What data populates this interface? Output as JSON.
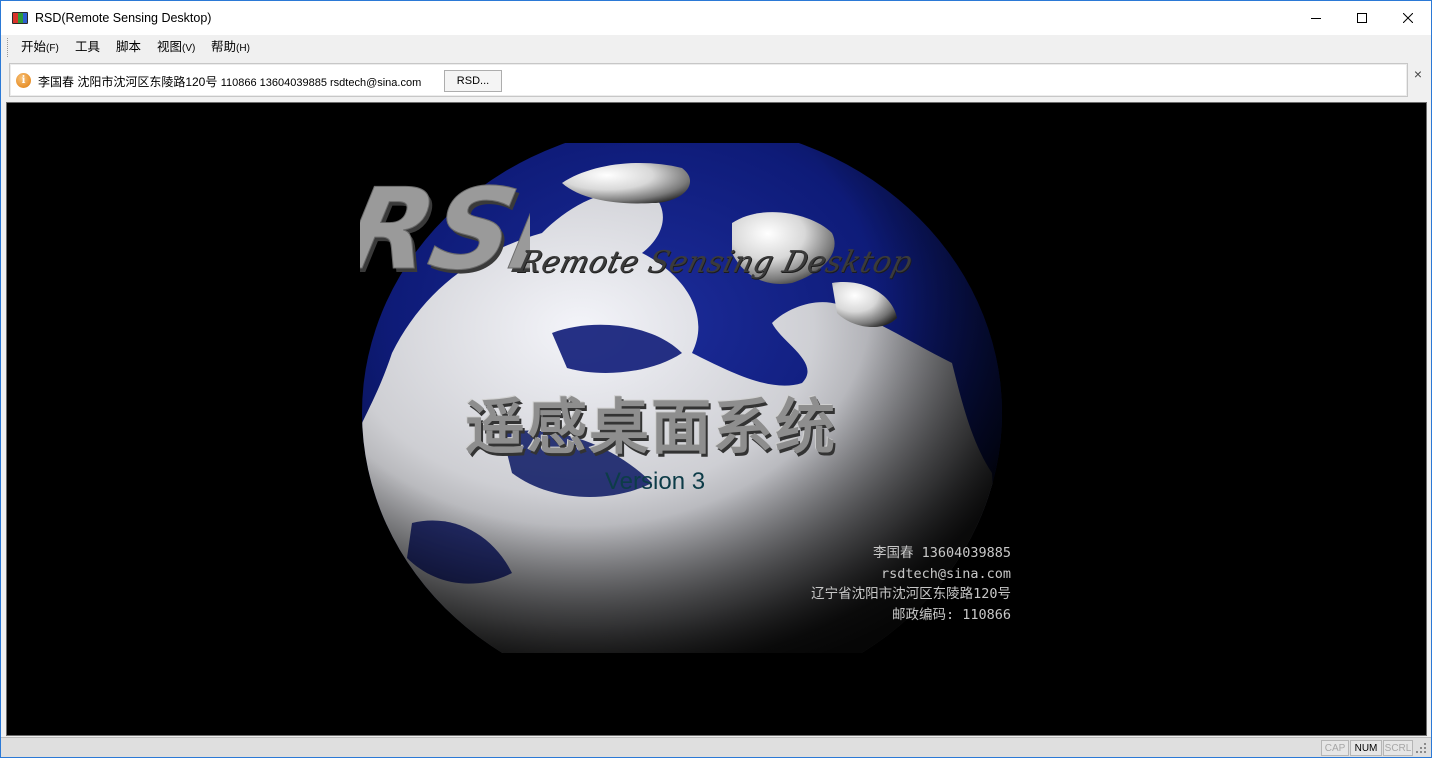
{
  "window": {
    "title": "RSD(Remote Sensing Desktop)",
    "icon": "rsd-app-icon"
  },
  "menubar": {
    "items": [
      {
        "label": "开始",
        "hotkey": "(F)"
      },
      {
        "label": "工具",
        "hotkey": ""
      },
      {
        "label": "脚本",
        "hotkey": ""
      },
      {
        "label": "视图",
        "hotkey": "(V)"
      },
      {
        "label": "帮助",
        "hotkey": "(H)"
      }
    ]
  },
  "infobar": {
    "icon": "info-icon",
    "text_main": "李国春 沈阳市沈河区东陵路120号",
    "text_small": "110866 13604039885 rsdtech@sina.com",
    "button_label": "RSD...",
    "close_label": "×"
  },
  "splash": {
    "logo_text": "RSD",
    "subtitle": "Remote Sensing Desktop",
    "title_cn": "遥感桌面系统",
    "version": "Version 3",
    "contact": [
      "李国春 13604039885",
      "rsdtech@sina.com",
      "辽宁省沈阳市沈河区东陵路120号",
      "邮政编码: 110866"
    ]
  },
  "statusbar": {
    "cap": "CAP",
    "num": "NUM",
    "scrl": "SCRL"
  },
  "colors": {
    "ocean": "#0b1a6e",
    "background": "#000000",
    "chrome": "#f0f0f0",
    "window_border": "#2b79d6"
  }
}
